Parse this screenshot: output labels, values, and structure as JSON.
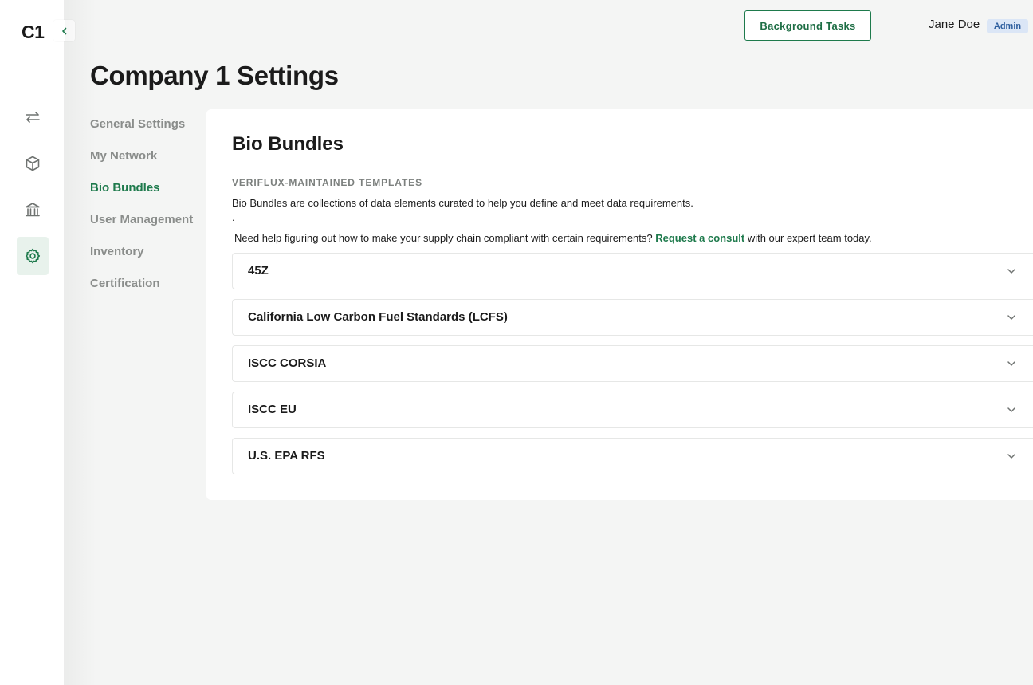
{
  "app": {
    "logo": "C1"
  },
  "header": {
    "background_tasks_label": "Background Tasks",
    "user_name": "Jane Doe",
    "user_role": "Admin"
  },
  "page": {
    "title": "Company 1 Settings"
  },
  "sidebar": {
    "icons": [
      "swap-arrows-icon",
      "cube-icon",
      "bank-icon",
      "gear-icon"
    ],
    "active": "gear-icon"
  },
  "settings_nav": {
    "items": [
      {
        "label": "General Settings"
      },
      {
        "label": "My Network"
      },
      {
        "label": "Bio Bundles"
      },
      {
        "label": "User Management"
      },
      {
        "label": "Inventory"
      },
      {
        "label": "Certification"
      }
    ],
    "active": "Bio Bundles"
  },
  "panel": {
    "title": "Bio Bundles",
    "section_label": "VERIFLUX-MAINTAINED TEMPLATES",
    "description": "Bio Bundles are collections of data elements curated to help you define and meet data requirements.",
    "dot": ".",
    "help_prefix": "Need help figuring out how to make your supply chain compliant with certain requirements? ",
    "help_link": "Request a consult",
    "help_suffix": " with our expert team today."
  },
  "bundles": [
    {
      "label": "45Z"
    },
    {
      "label": "California Low Carbon Fuel Standards (LCFS)"
    },
    {
      "label": "ISCC CORSIA"
    },
    {
      "label": "ISCC EU"
    },
    {
      "label": "U.S. EPA RFS"
    }
  ],
  "colors": {
    "accent": "#1e7a4c",
    "badge_bg": "#dbe6f6",
    "badge_text": "#2d5e9e",
    "muted": "#8a8d8b"
  }
}
